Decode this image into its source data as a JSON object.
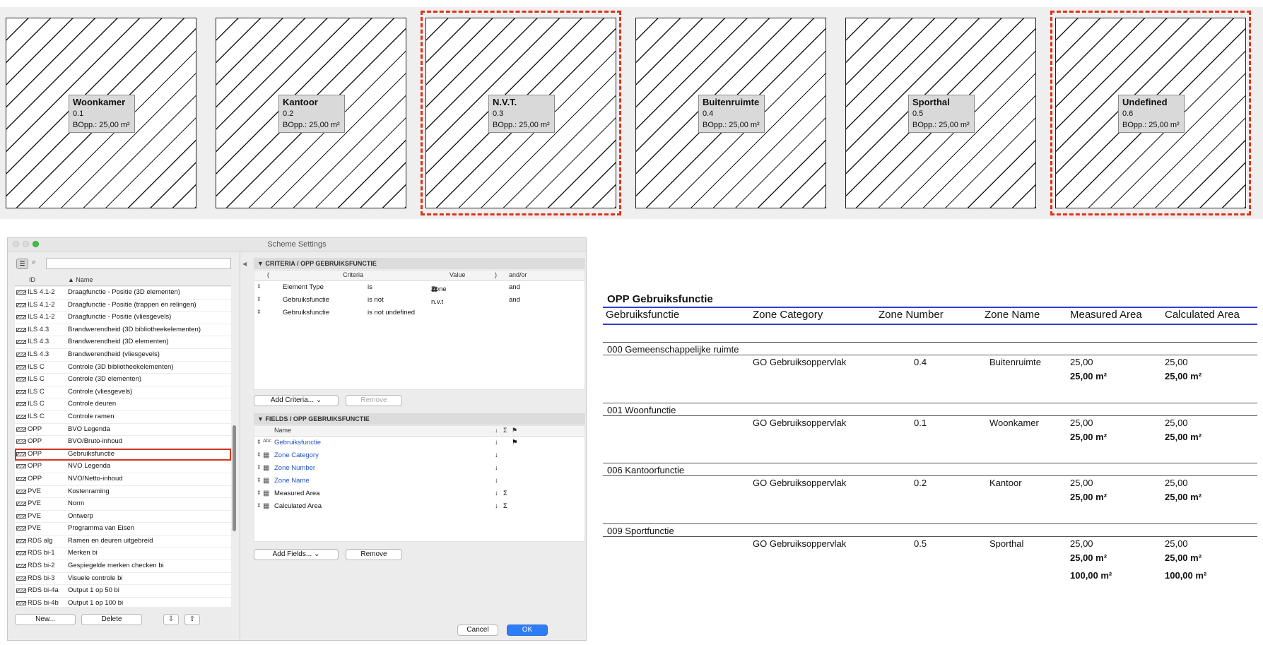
{
  "zones": [
    {
      "name": "Woonkamer",
      "number": "0.1",
      "area": "BOpp.: 25,00 m²",
      "highlighted": false
    },
    {
      "name": "Kantoor",
      "number": "0.2",
      "area": "BOpp.: 25,00 m²",
      "highlighted": false
    },
    {
      "name": "N.V.T.",
      "number": "0.3",
      "area": "BOpp.: 25,00 m²",
      "highlighted": true
    },
    {
      "name": "Buitenruimte",
      "number": "0.4",
      "area": "BOpp.: 25,00 m²",
      "highlighted": false
    },
    {
      "name": "Sporthal",
      "number": "0.5",
      "area": "BOpp.: 25,00 m²",
      "highlighted": false
    },
    {
      "name": "Undefined",
      "number": "0.6",
      "area": "BOpp.: 25,00 m²",
      "highlighted": true
    }
  ],
  "dialog": {
    "title": "Scheme Settings",
    "search": {
      "value": "",
      "placeholder": ""
    },
    "list_headers": {
      "id": "ID",
      "name": "▲ Name"
    },
    "schemes": [
      {
        "id": "ILS 4.1-2",
        "name": "Draagfunctie - Positie (3D elementen)"
      },
      {
        "id": "ILS 4.1-2",
        "name": "Draagfunctie - Positie (trappen en relingen)"
      },
      {
        "id": "ILS 4.1-2",
        "name": "Draagfunctie - Positie (vliesgevels)"
      },
      {
        "id": "ILS 4.3",
        "name": "Brandwerendheid (3D bibliotheekelementen)"
      },
      {
        "id": "ILS 4.3",
        "name": "Brandwerendheid (3D elementen)"
      },
      {
        "id": "ILS 4.3",
        "name": "Brandwerendheid (vliesgevels)"
      },
      {
        "id": "ILS C",
        "name": "Controle (3D bibliotheekelementen)"
      },
      {
        "id": "ILS C",
        "name": "Controle (3D elementen)"
      },
      {
        "id": "ILS C",
        "name": "Controle (vliesgevels)"
      },
      {
        "id": "ILS C",
        "name": "Controle deuren"
      },
      {
        "id": "ILS C",
        "name": "Controle ramen"
      },
      {
        "id": "OPP",
        "name": "BVO Legenda"
      },
      {
        "id": "OPP",
        "name": "BVO/Bruto-inhoud"
      },
      {
        "id": "OPP",
        "name": "Gebruiksfunctie",
        "selected": true
      },
      {
        "id": "OPP",
        "name": "NVO Legenda"
      },
      {
        "id": "OPP",
        "name": "NVO/Netto-inhoud"
      },
      {
        "id": "PVE",
        "name": "Kostenraming"
      },
      {
        "id": "PVE",
        "name": "Norm"
      },
      {
        "id": "PVE",
        "name": "Ontwerp"
      },
      {
        "id": "PVE",
        "name": "Programma van Eisen"
      },
      {
        "id": "RDS alg",
        "name": "Ramen en deuren uitgebreid"
      },
      {
        "id": "RDS bi-1",
        "name": "Merken bi"
      },
      {
        "id": "RDS bi-2",
        "name": "Gespiegelde merken checken bi"
      },
      {
        "id": "RDS bi-3",
        "name": "Visuele controle bi"
      },
      {
        "id": "RDS bi-4a",
        "name": "Output 1 op  50 bi"
      },
      {
        "id": "RDS bi-4b",
        "name": "Output 1 op 100 bi"
      }
    ],
    "buttons": {
      "new": "New...",
      "delete": "Delete",
      "cancel": "Cancel",
      "ok": "OK",
      "add_criteria": "Add Criteria...",
      "remove_criteria": "Remove",
      "add_fields": "Add Fields...",
      "remove_fields": "Remove"
    },
    "criteria": {
      "header": "CRITERIA / OPP GEBRUIKSFUNCTIE",
      "columns": {
        "open": "(",
        "criteria": "Criteria",
        "value": "Value",
        "close": ")",
        "andor": "and/or"
      },
      "rows": [
        {
          "criteria": "Element Type",
          "op": "is",
          "value": "Zone",
          "andor": "and",
          "zone_icon": true
        },
        {
          "criteria": "Gebruiksfunctie",
          "op": "is not",
          "value": "n.v.t",
          "andor": "and",
          "zone_icon": false
        },
        {
          "criteria": "Gebruiksfunctie",
          "op": "is not undefined",
          "value": "",
          "andor": "",
          "zone_icon": false
        }
      ]
    },
    "fields": {
      "header": "FIELDS / OPP GEBRUIKSFUNCTIE",
      "columns": {
        "name": "Name",
        "sort": "↓",
        "sum": "Σ",
        "flag": "⚑"
      },
      "rows": [
        {
          "name": "Gebruiksfunctie",
          "kind": "Abc",
          "sort": "↓",
          "sum": "",
          "flag": "⚑",
          "linked": true
        },
        {
          "name": "Zone Category",
          "kind": "zone",
          "sort": "↓",
          "sum": "",
          "flag": "",
          "linked": true
        },
        {
          "name": "Zone Number",
          "kind": "zone",
          "sort": "↓",
          "sum": "",
          "flag": "",
          "linked": true
        },
        {
          "name": "Zone Name",
          "kind": "zone",
          "sort": "↓",
          "sum": "",
          "flag": "",
          "linked": true
        },
        {
          "name": "Measured Area",
          "kind": "zone",
          "sort": "↓",
          "sum": "Σ",
          "flag": "",
          "linked": false
        },
        {
          "name": "Calculated Area",
          "kind": "zone",
          "sort": "↓",
          "sum": "Σ",
          "flag": "",
          "linked": false
        }
      ]
    }
  },
  "report": {
    "title": "OPP Gebruiksfunctie",
    "columns": [
      "Gebruiksfunctie",
      "Zone Category",
      "Zone Number",
      "Zone Name",
      "Measured Area",
      "Calculated Area"
    ],
    "groups": [
      {
        "label": "000 Gemeenschappelijke ruimte",
        "category": "GO Gebruiksoppervlak",
        "number": "0.4",
        "zone_name": "Buitenruimte",
        "measured": "25,00",
        "calculated": "25,00",
        "measured_sub": "25,00 m²",
        "calculated_sub": "25,00 m²"
      },
      {
        "label": "001 Woonfunctie",
        "category": "GO Gebruiksoppervlak",
        "number": "0.1",
        "zone_name": "Woonkamer",
        "measured": "25,00",
        "calculated": "25,00",
        "measured_sub": "25,00 m²",
        "calculated_sub": "25,00 m²"
      },
      {
        "label": "006 Kantoorfunctie",
        "category": "GO Gebruiksoppervlak",
        "number": "0.2",
        "zone_name": "Kantoor",
        "measured": "25,00",
        "calculated": "25,00",
        "measured_sub": "25,00 m²",
        "calculated_sub": "25,00 m²"
      },
      {
        "label": "009 Sportfunctie",
        "category": "GO Gebruiksoppervlak",
        "number": "0.5",
        "zone_name": "Sporthal",
        "measured": "25,00",
        "calculated": "25,00",
        "measured_sub": "25,00 m²",
        "calculated_sub": "25,00 m²"
      }
    ],
    "grand_total": {
      "measured": "100,00 m²",
      "calculated": "100,00 m²"
    }
  }
}
